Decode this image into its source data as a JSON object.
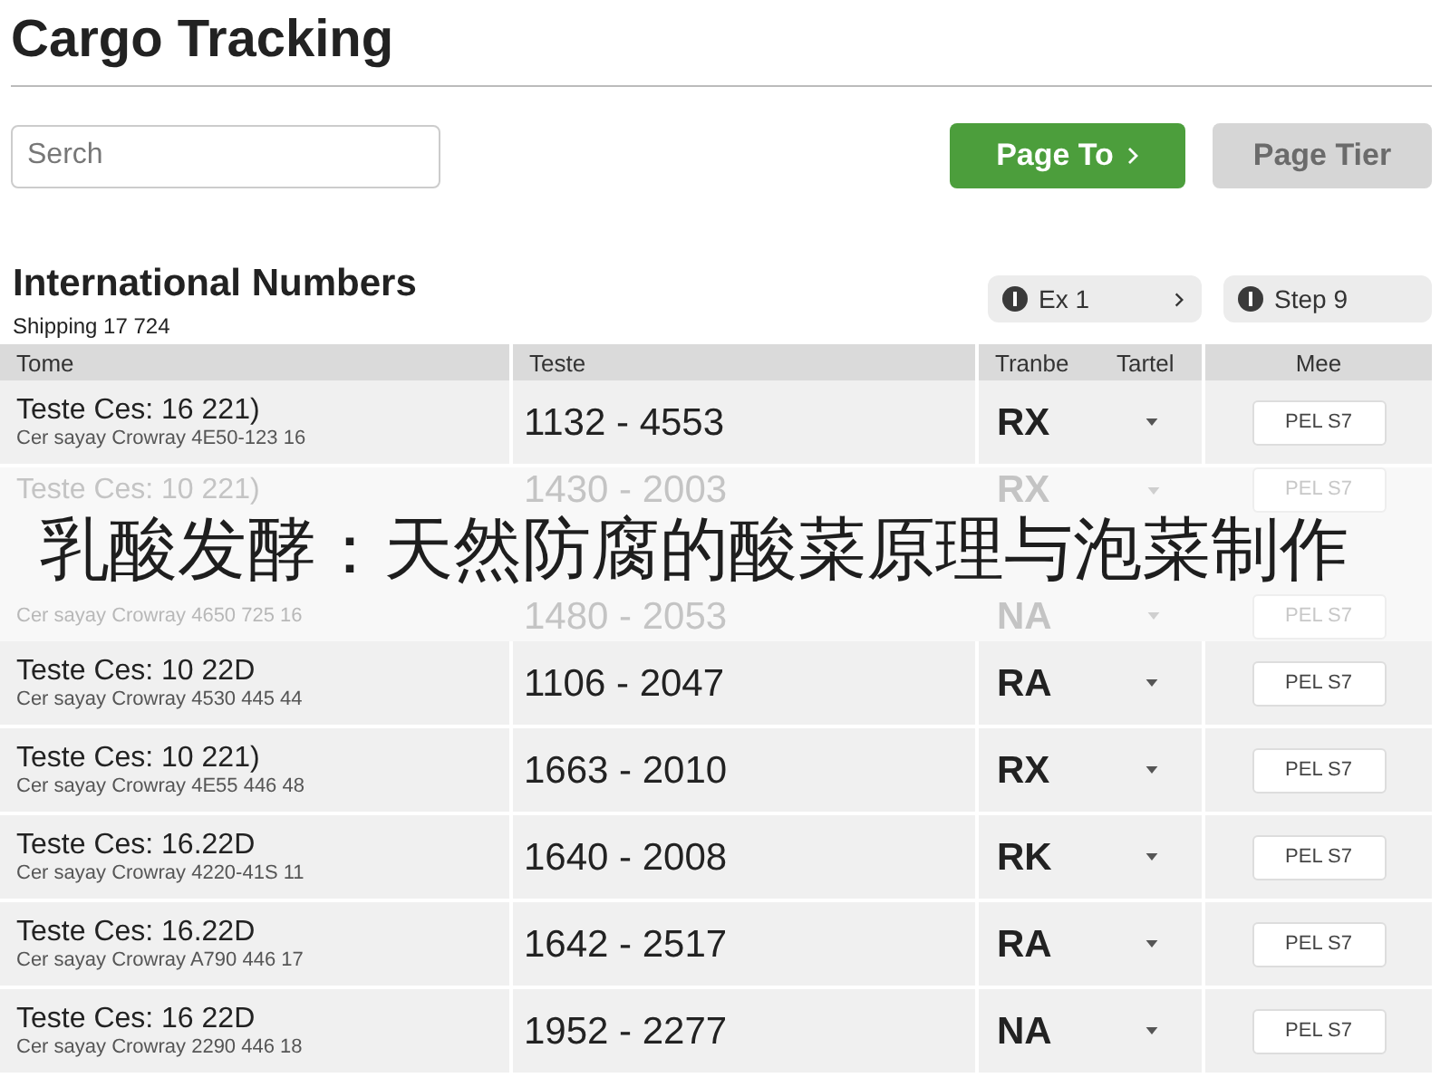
{
  "title": "Cargo Tracking",
  "search": {
    "placeholder": "Serch"
  },
  "buttons": [
    {
      "label": "Page To",
      "kind": "next",
      "disabled": false
    },
    {
      "label": "Page Tier",
      "kind": "plain",
      "disabled": true
    }
  ],
  "section": {
    "title": "International Numbers",
    "subtitle": "Shipping 17 724"
  },
  "pager": [
    {
      "label": "Ex 1",
      "kind": "next"
    },
    {
      "label": "Step 9",
      "kind": "plain"
    }
  ],
  "table": {
    "columns": [
      "Tome",
      "Teste",
      "Tranbe",
      "Tartel",
      "Mee"
    ],
    "rows": [
      {
        "name": "Teste Ces: 16 221)",
        "detail": "Cer sayay Crowray 4E50-123 16",
        "range": "1132 - 4553",
        "code": "RX",
        "action": "PEL S7"
      },
      {
        "name": "Teste Ces: 10 221)",
        "range": "1430 - 2003",
        "code": "RX",
        "action": "PEL S7"
      },
      {
        "detail": "Cer sayay Crowray 4650 725 16",
        "range": "1480 - 2053",
        "code": "NA",
        "action": "PEL S7"
      },
      {
        "name": "Teste Ces: 10 22D",
        "detail": "Cer sayay Crowray 4530 445 44",
        "range": "1106 - 2047",
        "code": "RA",
        "action": "PEL S7"
      },
      {
        "name": "Teste Ces: 10 221)",
        "detail": "Cer sayay Crowray 4E55 446 48",
        "range": "1663 - 2010",
        "code": "RX",
        "action": "PEL S7"
      },
      {
        "name": "Teste Ces: 16.22D",
        "detail": "Cer sayay Crowray 4220-41S 11",
        "range": "1640 - 2008",
        "code": "RK",
        "action": "PEL S7"
      },
      {
        "name": "Teste Ces: 16.22D",
        "detail": "Cer sayay Crowray A790 446 17",
        "range": "1642 - 2517",
        "code": "RA",
        "action": "PEL S7"
      },
      {
        "name": "Teste Ces: 16 22D",
        "detail": "Cer sayay Crowray 2290 446 18",
        "range": "1952 - 2277",
        "code": "NA",
        "action": "PEL S7"
      }
    ]
  },
  "banner": {
    "title": "乳酸发酵：天然防腐的酸菜原理与泡菜制作"
  }
}
